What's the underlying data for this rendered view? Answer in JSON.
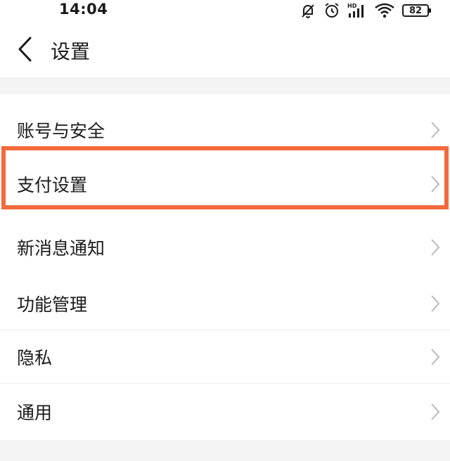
{
  "status_bar": {
    "time": "14:04",
    "battery": "82",
    "network_label": "HD",
    "icons": [
      "notifications-off-icon",
      "alarm-icon",
      "signal-icon",
      "wifi-icon",
      "battery-icon"
    ]
  },
  "header": {
    "back_icon": "chevron-left-icon",
    "title": "设置"
  },
  "settings": {
    "items": [
      {
        "label": "账号与安全",
        "highlighted": false
      },
      {
        "label": "支付设置",
        "highlighted": true
      },
      {
        "label": "新消息通知",
        "highlighted": false
      },
      {
        "label": "功能管理",
        "highlighted": false
      },
      {
        "label": "隐私",
        "highlighted": false
      },
      {
        "label": "通用",
        "highlighted": false
      }
    ]
  },
  "colors": {
    "highlight": "#f36a3c",
    "separator": "#f4f4f4",
    "text": "#1a1a1a",
    "chevron": "#b9b9b9"
  }
}
